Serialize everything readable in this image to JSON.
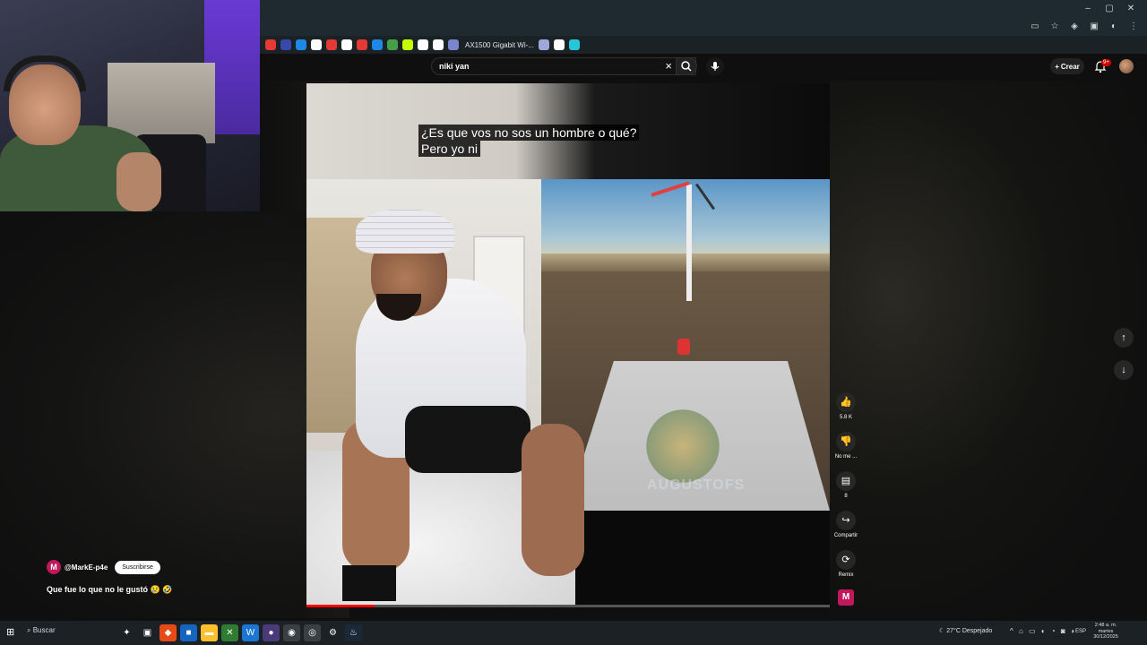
{
  "browser": {
    "window_controls": [
      "–",
      "▢",
      "✕"
    ],
    "bookmark_label": "AX1500 Gigabit Wi-...",
    "bookmark_colors": [
      "#e53935",
      "#3949ab",
      "#1e88e5",
      "#ffffff",
      "#e53935",
      "#ffffff",
      "#e53935",
      "#1e88e5",
      "#43a047",
      "#c6ff00",
      "#ffffff",
      "#ffffff",
      "#7986cb",
      "#9fa8da",
      "#ffffff",
      "#26c6da"
    ]
  },
  "header": {
    "search_value": "niki yan",
    "clear_icon": "close-icon",
    "search_icon": "search-icon",
    "mic_icon": "mic-icon",
    "create_label": "Crear",
    "notifications_badge": "9+"
  },
  "video": {
    "caption_line1": "¿Es que vos no sos un hombre o qué?",
    "caption_line2": "Pero yo ni",
    "watermark": "AUGUSTOFS",
    "progress_fraction": 0.13
  },
  "actions": {
    "like_count": "5.8 K",
    "dislike_label": "No me ...",
    "comments_count": "8",
    "share_label": "Compartir",
    "remix_label": "Remix",
    "channel_initial": "M"
  },
  "channel": {
    "avatar_initial": "M",
    "handle": "@MarkE-p4e",
    "subscribe_label": "Suscribirse",
    "video_title": "Que fue lo que no le gustó 😢 🤣"
  },
  "taskbar": {
    "search_label": "Buscar",
    "weather": "27°C Despejado",
    "language": "ESP",
    "time": "2:48 a. m.",
    "day": "martes",
    "date": "30/12/2025"
  }
}
